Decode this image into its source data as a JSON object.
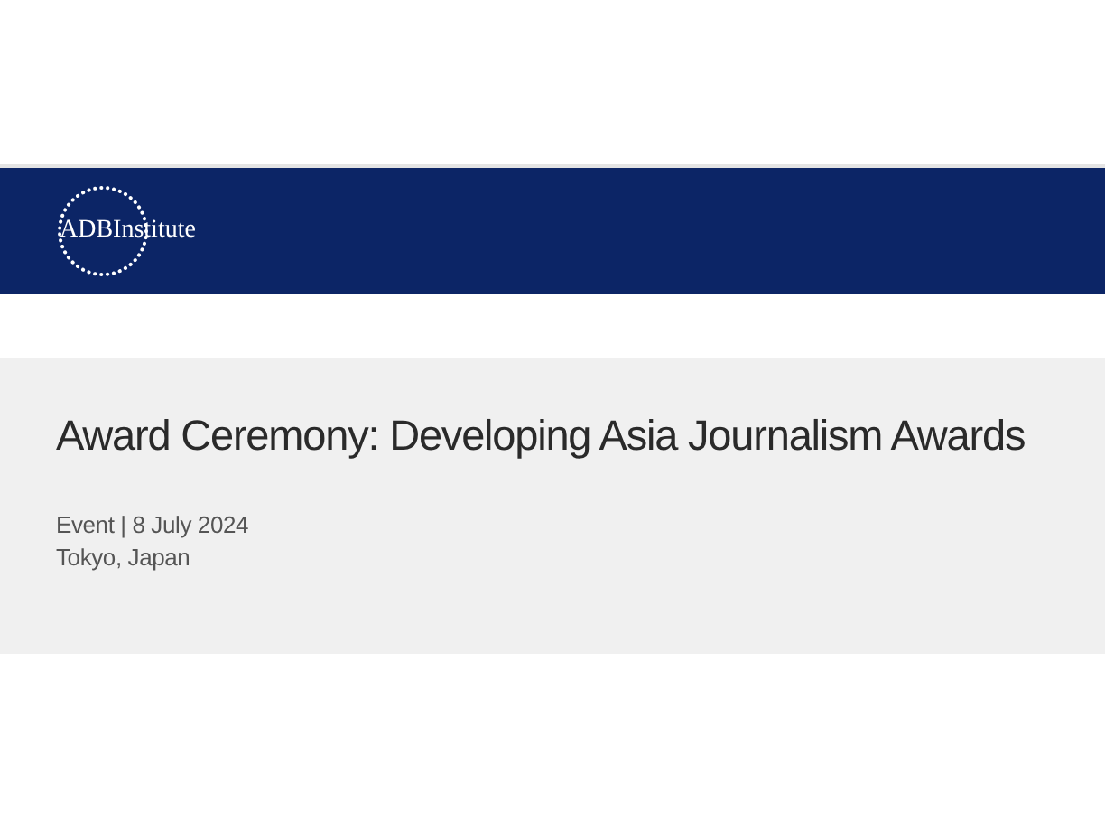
{
  "header": {
    "logo_text": "ADBInstitute"
  },
  "event": {
    "title": "Award Ceremony: Developing Asia Journalism Awards",
    "meta": "Event | 8 July 2024",
    "location": "Tokyo, Japan"
  }
}
